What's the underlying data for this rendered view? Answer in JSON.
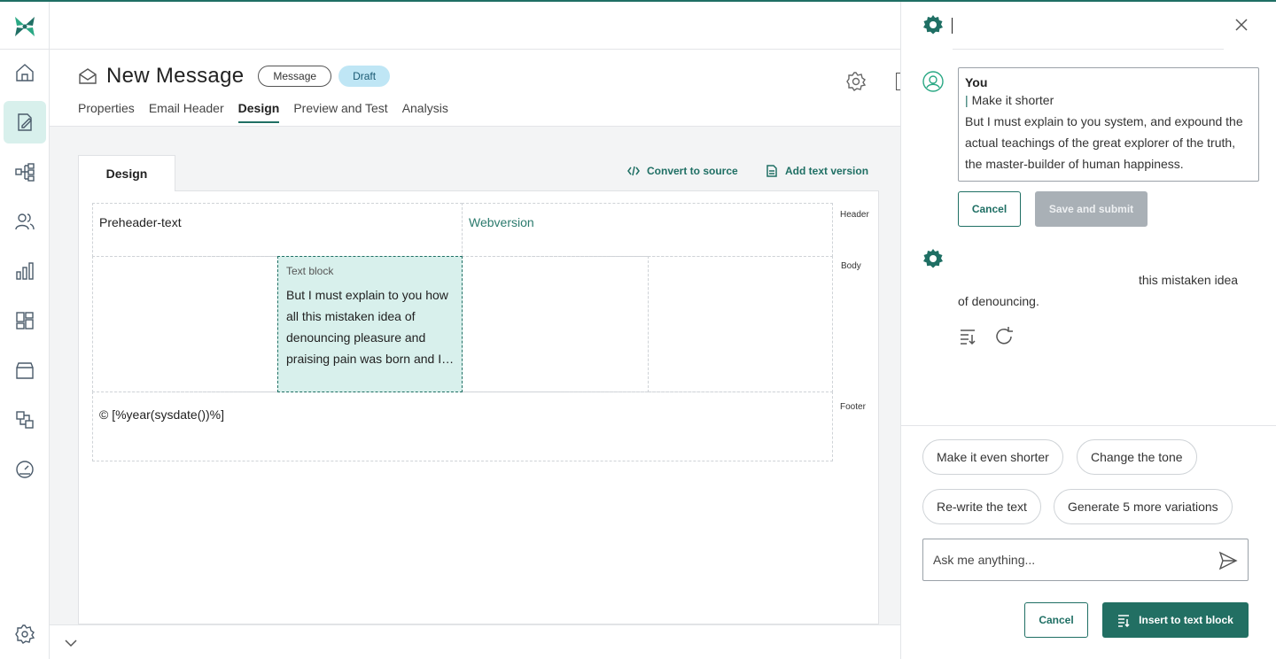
{
  "header": {
    "title": "New Message",
    "type_pill": "Message",
    "status_pill": "Draft",
    "tabs": [
      {
        "label": "Properties"
      },
      {
        "label": "Email Header"
      },
      {
        "label": "Design",
        "active": true
      },
      {
        "label": "Preview and Test"
      },
      {
        "label": "Analysis"
      }
    ]
  },
  "design": {
    "tab_label": "Design",
    "convert_label": "Convert to source",
    "add_text_label": "Add text version",
    "zones": {
      "header": "Header",
      "body": "Body",
      "footer": "Footer"
    },
    "preheader": "Preheader-text",
    "webversion": "Webversion",
    "text_block_label": "Text block",
    "text_block_content": "But I must explain to you how all this mistaken idea of denouncing pleasure and praising pain was born and I…",
    "footer_text": "© [%year(sysdate())%]"
  },
  "assistant": {
    "user_name": "You",
    "prompt": "Make it shorter",
    "user_message": "But I must explain to you system, and expound the actual teachings of the great explorer of the truth, the master-builder of human happiness.",
    "cancel_label": "Cancel",
    "save_label": "Save and submit",
    "reply_visible": "this mistaken idea",
    "reply_line2": "of denouncing.",
    "suggestions": [
      "Make it even shorter",
      "Change the tone",
      "Re-write the text",
      "Generate 5 more variations"
    ],
    "input_placeholder": "Ask me anything...",
    "footer_cancel_label": "Cancel",
    "insert_label": "Insert to text block"
  },
  "colors": {
    "accent": "#1f6f64",
    "active_bg": "#d8f0ec",
    "draft_bg": "#bfe6f5"
  }
}
